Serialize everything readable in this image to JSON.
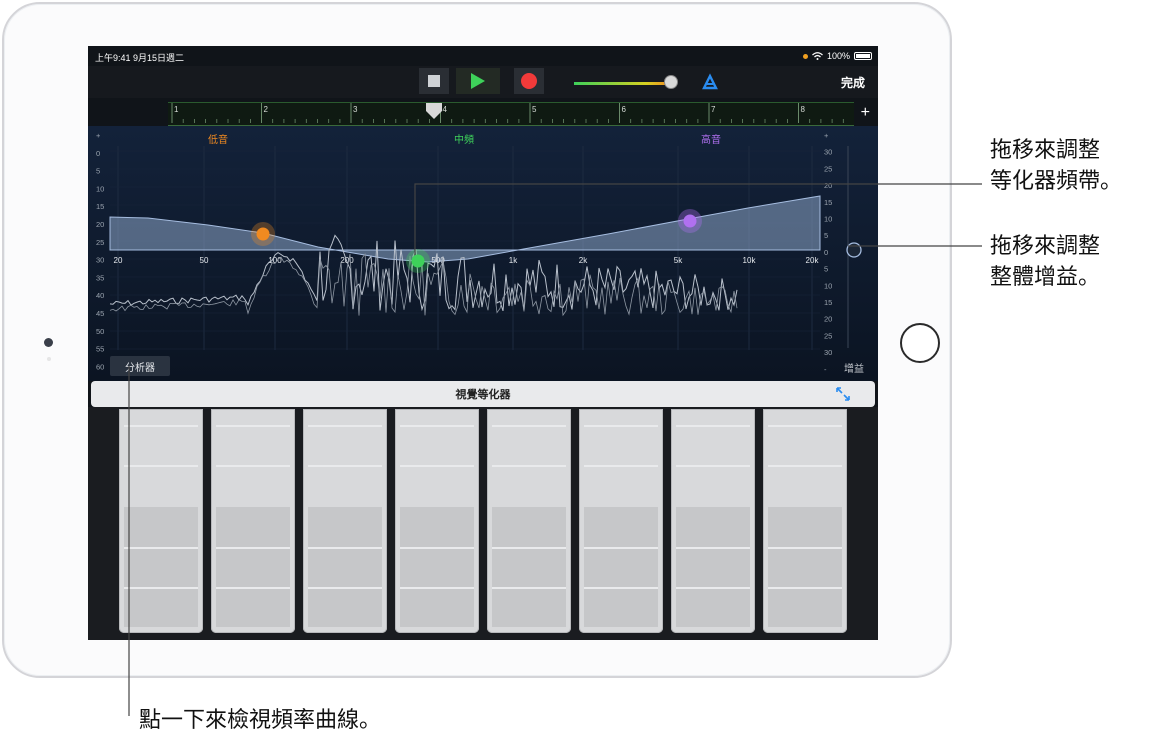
{
  "status_bar": {
    "time": "上午9:41  9月15日週二",
    "battery": "100%"
  },
  "toolbar": {
    "done_label": "完成"
  },
  "ruler": {
    "bars": [
      "1",
      "2",
      "3",
      "4",
      "5",
      "6",
      "7",
      "8"
    ]
  },
  "eq": {
    "bands": [
      {
        "label": "低音",
        "color": "#f08a20"
      },
      {
        "label": "中頻",
        "color": "#3ed15a"
      },
      {
        "label": "高音",
        "color": "#b070f0"
      }
    ],
    "freq_labels": [
      "20",
      "50",
      "100",
      "200",
      "500",
      "1k",
      "2k",
      "5k",
      "10k",
      "20k"
    ],
    "left_db_labels": [
      "+",
      "0",
      "5",
      "10",
      "15",
      "20",
      "25",
      "30",
      "35",
      "40",
      "45",
      "50",
      "55",
      "60"
    ],
    "right_db_labels": [
      "+",
      "30",
      "25",
      "20",
      "15",
      "10",
      "5",
      "0",
      "5",
      "10",
      "15",
      "20",
      "25",
      "30",
      "-"
    ],
    "gain_label": "增益",
    "analyzer_label": "分析器"
  },
  "eq_panel": {
    "title": "視覺等化器"
  },
  "faders": {
    "count": 8
  },
  "callouts": {
    "band_drag": [
      "拖移來調整",
      "等化器頻帶。"
    ],
    "gain_drag": [
      "拖移來調整",
      "整體增益。"
    ],
    "analyzer_tap": "點一下來檢視頻率曲線。"
  }
}
